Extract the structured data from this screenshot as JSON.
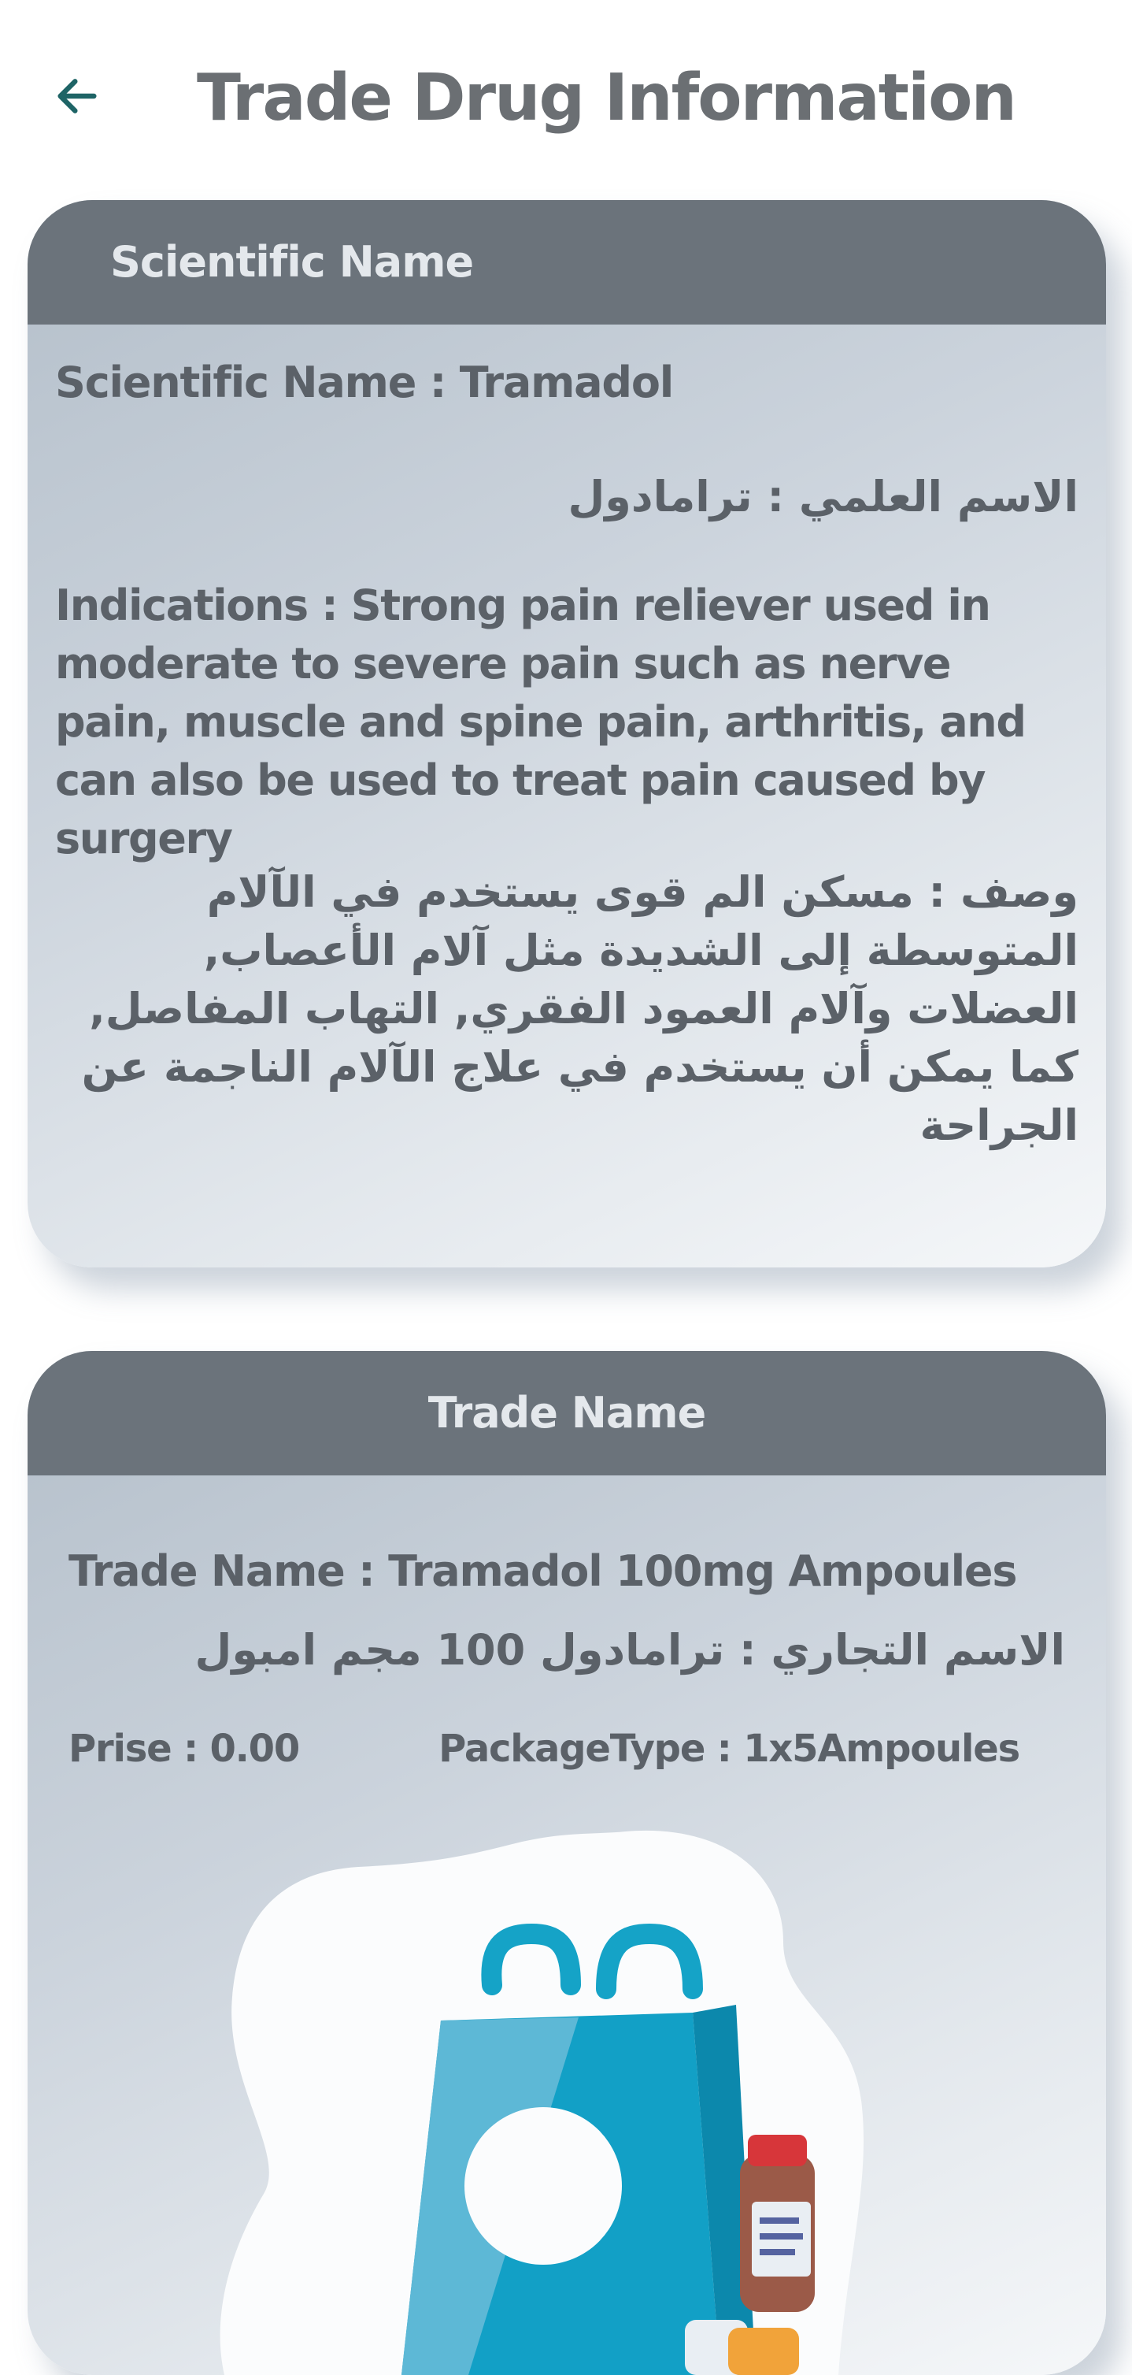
{
  "header": {
    "title": "Trade Drug Information",
    "back_icon": "arrow-left-icon",
    "accent_color": "#1e6466"
  },
  "scientific_card": {
    "header_label": "Scientific Name",
    "scientific_name_label": "Scientific Name : ",
    "scientific_name_value": "Tramadol",
    "scientific_name_ar_label": "الاسم العلمي : ",
    "scientific_name_ar_value": "ترامادول",
    "indications_label": "Indications : ",
    "indications_text": "Strong pain reliever used in moderate to severe pain such as nerve pain, muscle and spine pain, arthritis, and can also be used to treat pain caused by surgery",
    "indications_ar_label": "وصف : ",
    "indications_ar_text": "مسكن الم قوى يستخدم في الآلام المتوسطة إلى الشديدة مثل آلام الأعصاب, العضلات وآلام العمود الفقري, التهاب المفاصل, كما يمكن أن يستخدم في علاج الآلام الناجمة عن الجراحة"
  },
  "trade_card": {
    "header_label": "Trade Name",
    "trade_name_label": "Trade Name : ",
    "trade_name_value": "Tramadol 100mg Ampoules",
    "trade_name_ar_label": "الاسم التجاري : ",
    "trade_name_ar_value": "ترامادول 100 مجم امبول",
    "price_label": "Prise : ",
    "price_value": "0.00",
    "package_label": "PackageType : ",
    "package_value": "1x5Ampoules",
    "illustration": "pharmacy-bag-illustration"
  },
  "colors": {
    "card_header": "#6b737b",
    "card_header_text": "#e4e8ec",
    "body_text": "#5b6168",
    "title_text": "#6b6f73"
  }
}
